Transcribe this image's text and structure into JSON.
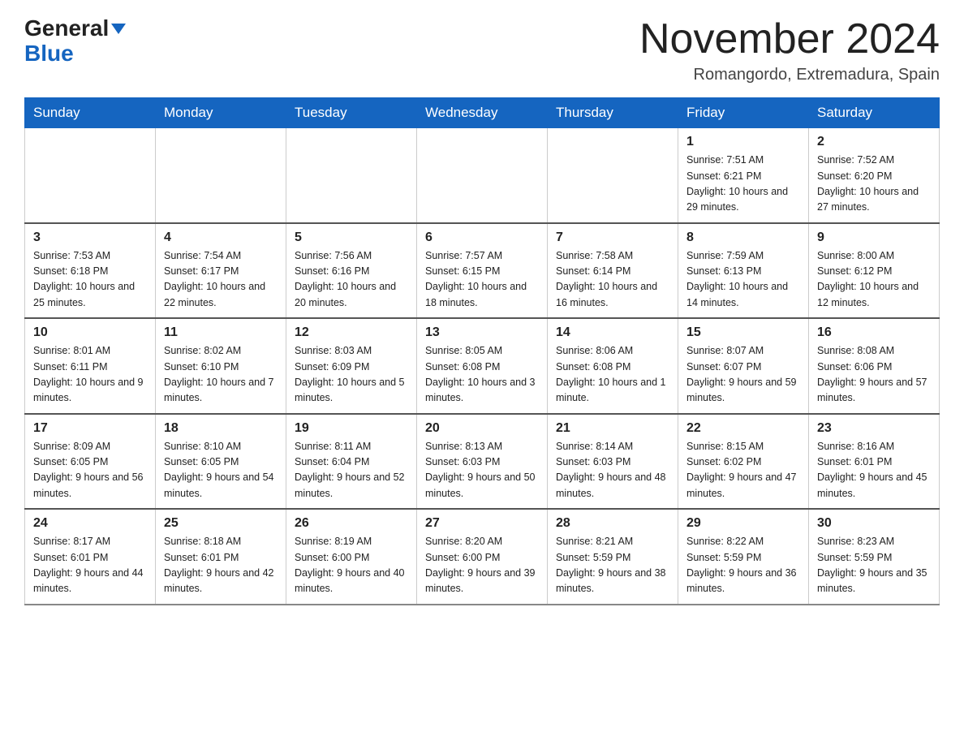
{
  "header": {
    "logo_general": "General",
    "logo_blue": "Blue",
    "title": "November 2024",
    "location": "Romangordo, Extremadura, Spain"
  },
  "days_of_week": [
    "Sunday",
    "Monday",
    "Tuesday",
    "Wednesday",
    "Thursday",
    "Friday",
    "Saturday"
  ],
  "weeks": [
    [
      {
        "day": "",
        "sunrise": "",
        "sunset": "",
        "daylight": ""
      },
      {
        "day": "",
        "sunrise": "",
        "sunset": "",
        "daylight": ""
      },
      {
        "day": "",
        "sunrise": "",
        "sunset": "",
        "daylight": ""
      },
      {
        "day": "",
        "sunrise": "",
        "sunset": "",
        "daylight": ""
      },
      {
        "day": "",
        "sunrise": "",
        "sunset": "",
        "daylight": ""
      },
      {
        "day": "1",
        "sunrise": "Sunrise: 7:51 AM",
        "sunset": "Sunset: 6:21 PM",
        "daylight": "Daylight: 10 hours and 29 minutes."
      },
      {
        "day": "2",
        "sunrise": "Sunrise: 7:52 AM",
        "sunset": "Sunset: 6:20 PM",
        "daylight": "Daylight: 10 hours and 27 minutes."
      }
    ],
    [
      {
        "day": "3",
        "sunrise": "Sunrise: 7:53 AM",
        "sunset": "Sunset: 6:18 PM",
        "daylight": "Daylight: 10 hours and 25 minutes."
      },
      {
        "day": "4",
        "sunrise": "Sunrise: 7:54 AM",
        "sunset": "Sunset: 6:17 PM",
        "daylight": "Daylight: 10 hours and 22 minutes."
      },
      {
        "day": "5",
        "sunrise": "Sunrise: 7:56 AM",
        "sunset": "Sunset: 6:16 PM",
        "daylight": "Daylight: 10 hours and 20 minutes."
      },
      {
        "day": "6",
        "sunrise": "Sunrise: 7:57 AM",
        "sunset": "Sunset: 6:15 PM",
        "daylight": "Daylight: 10 hours and 18 minutes."
      },
      {
        "day": "7",
        "sunrise": "Sunrise: 7:58 AM",
        "sunset": "Sunset: 6:14 PM",
        "daylight": "Daylight: 10 hours and 16 minutes."
      },
      {
        "day": "8",
        "sunrise": "Sunrise: 7:59 AM",
        "sunset": "Sunset: 6:13 PM",
        "daylight": "Daylight: 10 hours and 14 minutes."
      },
      {
        "day": "9",
        "sunrise": "Sunrise: 8:00 AM",
        "sunset": "Sunset: 6:12 PM",
        "daylight": "Daylight: 10 hours and 12 minutes."
      }
    ],
    [
      {
        "day": "10",
        "sunrise": "Sunrise: 8:01 AM",
        "sunset": "Sunset: 6:11 PM",
        "daylight": "Daylight: 10 hours and 9 minutes."
      },
      {
        "day": "11",
        "sunrise": "Sunrise: 8:02 AM",
        "sunset": "Sunset: 6:10 PM",
        "daylight": "Daylight: 10 hours and 7 minutes."
      },
      {
        "day": "12",
        "sunrise": "Sunrise: 8:03 AM",
        "sunset": "Sunset: 6:09 PM",
        "daylight": "Daylight: 10 hours and 5 minutes."
      },
      {
        "day": "13",
        "sunrise": "Sunrise: 8:05 AM",
        "sunset": "Sunset: 6:08 PM",
        "daylight": "Daylight: 10 hours and 3 minutes."
      },
      {
        "day": "14",
        "sunrise": "Sunrise: 8:06 AM",
        "sunset": "Sunset: 6:08 PM",
        "daylight": "Daylight: 10 hours and 1 minute."
      },
      {
        "day": "15",
        "sunrise": "Sunrise: 8:07 AM",
        "sunset": "Sunset: 6:07 PM",
        "daylight": "Daylight: 9 hours and 59 minutes."
      },
      {
        "day": "16",
        "sunrise": "Sunrise: 8:08 AM",
        "sunset": "Sunset: 6:06 PM",
        "daylight": "Daylight: 9 hours and 57 minutes."
      }
    ],
    [
      {
        "day": "17",
        "sunrise": "Sunrise: 8:09 AM",
        "sunset": "Sunset: 6:05 PM",
        "daylight": "Daylight: 9 hours and 56 minutes."
      },
      {
        "day": "18",
        "sunrise": "Sunrise: 8:10 AM",
        "sunset": "Sunset: 6:05 PM",
        "daylight": "Daylight: 9 hours and 54 minutes."
      },
      {
        "day": "19",
        "sunrise": "Sunrise: 8:11 AM",
        "sunset": "Sunset: 6:04 PM",
        "daylight": "Daylight: 9 hours and 52 minutes."
      },
      {
        "day": "20",
        "sunrise": "Sunrise: 8:13 AM",
        "sunset": "Sunset: 6:03 PM",
        "daylight": "Daylight: 9 hours and 50 minutes."
      },
      {
        "day": "21",
        "sunrise": "Sunrise: 8:14 AM",
        "sunset": "Sunset: 6:03 PM",
        "daylight": "Daylight: 9 hours and 48 minutes."
      },
      {
        "day": "22",
        "sunrise": "Sunrise: 8:15 AM",
        "sunset": "Sunset: 6:02 PM",
        "daylight": "Daylight: 9 hours and 47 minutes."
      },
      {
        "day": "23",
        "sunrise": "Sunrise: 8:16 AM",
        "sunset": "Sunset: 6:01 PM",
        "daylight": "Daylight: 9 hours and 45 minutes."
      }
    ],
    [
      {
        "day": "24",
        "sunrise": "Sunrise: 8:17 AM",
        "sunset": "Sunset: 6:01 PM",
        "daylight": "Daylight: 9 hours and 44 minutes."
      },
      {
        "day": "25",
        "sunrise": "Sunrise: 8:18 AM",
        "sunset": "Sunset: 6:01 PM",
        "daylight": "Daylight: 9 hours and 42 minutes."
      },
      {
        "day": "26",
        "sunrise": "Sunrise: 8:19 AM",
        "sunset": "Sunset: 6:00 PM",
        "daylight": "Daylight: 9 hours and 40 minutes."
      },
      {
        "day": "27",
        "sunrise": "Sunrise: 8:20 AM",
        "sunset": "Sunset: 6:00 PM",
        "daylight": "Daylight: 9 hours and 39 minutes."
      },
      {
        "day": "28",
        "sunrise": "Sunrise: 8:21 AM",
        "sunset": "Sunset: 5:59 PM",
        "daylight": "Daylight: 9 hours and 38 minutes."
      },
      {
        "day": "29",
        "sunrise": "Sunrise: 8:22 AM",
        "sunset": "Sunset: 5:59 PM",
        "daylight": "Daylight: 9 hours and 36 minutes."
      },
      {
        "day": "30",
        "sunrise": "Sunrise: 8:23 AM",
        "sunset": "Sunset: 5:59 PM",
        "daylight": "Daylight: 9 hours and 35 minutes."
      }
    ]
  ]
}
